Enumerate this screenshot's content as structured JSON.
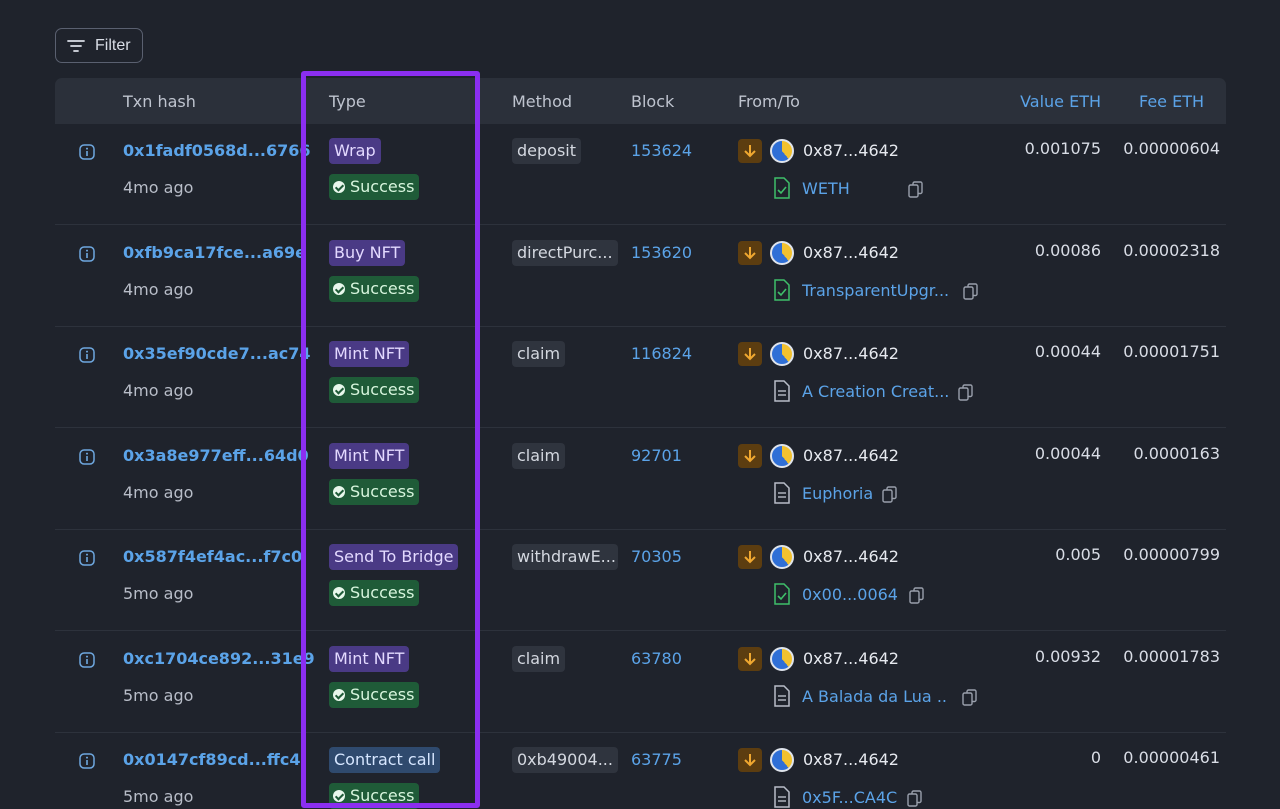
{
  "toolbar": {
    "filter_label": "Filter"
  },
  "columns": {
    "txn_hash": "Txn hash",
    "type": "Type",
    "method": "Method",
    "block": "Block",
    "from_to": "From/To",
    "value": "Value ETH",
    "fee": "Fee ETH"
  },
  "rows": [
    {
      "hash": "0x1fadf0568d...6766",
      "age": "4mo ago",
      "type": "Wrap",
      "status": "Success",
      "method": "deposit",
      "block": "153624",
      "from": "0x87...4642",
      "to": "WETH",
      "to_icon": "verified-contract-icon",
      "value": "0.001075",
      "fee": "0.00000604"
    },
    {
      "hash": "0xfb9ca17fce...a69e",
      "age": "4mo ago",
      "type": "Buy NFT",
      "status": "Success",
      "method": "directPurc...",
      "block": "153620",
      "from": "0x87...4642",
      "to": "TransparentUpgr...",
      "to_icon": "verified-contract-icon",
      "value": "0.00086",
      "fee": "0.00002318"
    },
    {
      "hash": "0x35ef90cde7...ac74",
      "age": "4mo ago",
      "type": "Mint NFT",
      "status": "Success",
      "method": "claim",
      "block": "116824",
      "from": "0x87...4642",
      "to": "A Creation Creat...",
      "to_icon": "contract-icon",
      "value": "0.00044",
      "fee": "0.00001751"
    },
    {
      "hash": "0x3a8e977eff...64d0",
      "age": "4mo ago",
      "type": "Mint NFT",
      "status": "Success",
      "method": "claim",
      "block": "92701",
      "from": "0x87...4642",
      "to": "Euphoria",
      "to_icon": "contract-icon",
      "value": "0.00044",
      "fee": "0.0000163"
    },
    {
      "hash": "0x587f4ef4ac...f7c0",
      "age": "5mo ago",
      "type": "Send To Bridge",
      "status": "Success",
      "method": "withdrawE...",
      "block": "70305",
      "from": "0x87...4642",
      "to": "0x00...0064",
      "to_icon": "verified-contract-icon",
      "value": "0.005",
      "fee": "0.00000799"
    },
    {
      "hash": "0xc1704ce892...31e9",
      "age": "5mo ago",
      "type": "Mint NFT",
      "status": "Success",
      "method": "claim",
      "block": "63780",
      "from": "0x87...4642",
      "to": "A Balada da Lua ...",
      "to_icon": "contract-icon",
      "value": "0.00932",
      "fee": "0.00001783"
    },
    {
      "hash": "0x0147cf89cd...ffc4",
      "age": "5mo ago",
      "type": "Contract call",
      "status": "Success",
      "method": "0xb49004...",
      "block": "63775",
      "from": "0x87...4642",
      "to": "0x5F...CA4C",
      "to_icon": "contract-icon",
      "value": "0",
      "fee": "0.00000461"
    }
  ],
  "colors": {
    "background": "#1f232c",
    "link": "#5ba3e8",
    "type_badge": "#4a3a85",
    "success_badge": "#1f5b38",
    "highlight": "#8b2ef0"
  }
}
